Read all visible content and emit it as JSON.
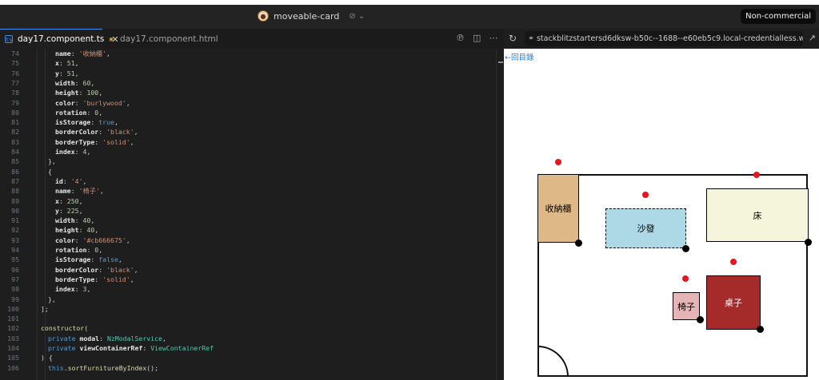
{
  "window": {
    "project_name": "moveable-card",
    "badge": "Non-commercial"
  },
  "tabs": [
    {
      "label": "day17.component.ts",
      "type_icon": "ts"
    },
    {
      "label": "day17.component.html",
      "type_icon": "html"
    }
  ],
  "browser": {
    "url": "stackblitzstartersd6dksw-b50c--1688--e60eb5c9.local-credentialless.we...",
    "back_link": "←回目錄"
  },
  "editor": {
    "lines": [
      {
        "n": "74",
        "tokens": [
          [
            "k",
            "name"
          ],
          [
            "p",
            ": "
          ],
          [
            "s",
            "'收納櫃'"
          ],
          [
            "p",
            ","
          ]
        ]
      },
      {
        "n": "75",
        "tokens": [
          [
            "k",
            "x"
          ],
          [
            "p",
            ": "
          ],
          [
            "n",
            "51"
          ],
          [
            "p",
            ","
          ]
        ]
      },
      {
        "n": "76",
        "tokens": [
          [
            "k",
            "y"
          ],
          [
            "p",
            ": "
          ],
          [
            "n",
            "51"
          ],
          [
            "p",
            ","
          ]
        ]
      },
      {
        "n": "77",
        "tokens": [
          [
            "k",
            "width"
          ],
          [
            "p",
            ": "
          ],
          [
            "n",
            "60"
          ],
          [
            "p",
            ","
          ]
        ]
      },
      {
        "n": "78",
        "tokens": [
          [
            "k",
            "height"
          ],
          [
            "p",
            ": "
          ],
          [
            "n",
            "100"
          ],
          [
            "p",
            ","
          ]
        ]
      },
      {
        "n": "79",
        "tokens": [
          [
            "k",
            "color"
          ],
          [
            "p",
            ": "
          ],
          [
            "s",
            "'burlywood'"
          ],
          [
            "p",
            ","
          ]
        ]
      },
      {
        "n": "80",
        "tokens": [
          [
            "k",
            "rotation"
          ],
          [
            "p",
            ": "
          ],
          [
            "n",
            "0"
          ],
          [
            "p",
            ","
          ]
        ]
      },
      {
        "n": "81",
        "tokens": [
          [
            "k",
            "isStorage"
          ],
          [
            "p",
            ": "
          ],
          [
            "kw",
            "true"
          ],
          [
            "p",
            ","
          ]
        ]
      },
      {
        "n": "82",
        "tokens": [
          [
            "k",
            "borderColor"
          ],
          [
            "p",
            ": "
          ],
          [
            "s",
            "'black'"
          ],
          [
            "p",
            ","
          ]
        ]
      },
      {
        "n": "83",
        "tokens": [
          [
            "k",
            "borderType"
          ],
          [
            "p",
            ": "
          ],
          [
            "s",
            "'solid'"
          ],
          [
            "p",
            ","
          ]
        ]
      },
      {
        "n": "84",
        "tokens": [
          [
            "k",
            "index"
          ],
          [
            "p",
            ": "
          ],
          [
            "n",
            "4"
          ],
          [
            "p",
            ","
          ]
        ]
      },
      {
        "n": "85",
        "tokens": [
          [
            "p",
            "},"
          ]
        ]
      },
      {
        "n": "86",
        "tokens": [
          [
            "p",
            "{"
          ]
        ]
      },
      {
        "n": "87",
        "tokens": [
          [
            "k",
            "id"
          ],
          [
            "p",
            ": "
          ],
          [
            "s",
            "'4'"
          ],
          [
            "p",
            ","
          ]
        ]
      },
      {
        "n": "88",
        "tokens": [
          [
            "k",
            "name"
          ],
          [
            "p",
            ": "
          ],
          [
            "s",
            "'椅子'"
          ],
          [
            "p",
            ","
          ]
        ]
      },
      {
        "n": "89",
        "tokens": [
          [
            "k",
            "x"
          ],
          [
            "p",
            ": "
          ],
          [
            "n",
            "250"
          ],
          [
            "p",
            ","
          ]
        ]
      },
      {
        "n": "90",
        "tokens": [
          [
            "k",
            "y"
          ],
          [
            "p",
            ": "
          ],
          [
            "n",
            "225"
          ],
          [
            "p",
            ","
          ]
        ]
      },
      {
        "n": "91",
        "tokens": [
          [
            "k",
            "width"
          ],
          [
            "p",
            ": "
          ],
          [
            "n",
            "40"
          ],
          [
            "p",
            ","
          ]
        ]
      },
      {
        "n": "92",
        "tokens": [
          [
            "k",
            "height"
          ],
          [
            "p",
            ": "
          ],
          [
            "n",
            "40"
          ],
          [
            "p",
            ","
          ]
        ]
      },
      {
        "n": "93",
        "tokens": [
          [
            "k",
            "color"
          ],
          [
            "p",
            ": "
          ],
          [
            "s",
            "'#cb666675'"
          ],
          [
            "p",
            ","
          ]
        ]
      },
      {
        "n": "94",
        "tokens": [
          [
            "k",
            "rotation"
          ],
          [
            "p",
            ": "
          ],
          [
            "n",
            "0"
          ],
          [
            "p",
            ","
          ]
        ]
      },
      {
        "n": "95",
        "tokens": [
          [
            "k",
            "isStorage"
          ],
          [
            "p",
            ": "
          ],
          [
            "kw",
            "false"
          ],
          [
            "p",
            ","
          ]
        ]
      },
      {
        "n": "96",
        "tokens": [
          [
            "k",
            "borderColor"
          ],
          [
            "p",
            ": "
          ],
          [
            "s",
            "'black'"
          ],
          [
            "p",
            ","
          ]
        ]
      },
      {
        "n": "97",
        "tokens": [
          [
            "k",
            "borderType"
          ],
          [
            "p",
            ": "
          ],
          [
            "s",
            "'solid'"
          ],
          [
            "p",
            ","
          ]
        ]
      },
      {
        "n": "98",
        "tokens": [
          [
            "k",
            "index"
          ],
          [
            "p",
            ": "
          ],
          [
            "n",
            "3"
          ],
          [
            "p",
            ","
          ]
        ]
      },
      {
        "n": "99",
        "tokens": [
          [
            "p",
            "},"
          ]
        ]
      },
      {
        "n": "100",
        "tokens": [
          [
            "p",
            "];"
          ]
        ]
      },
      {
        "n": "101",
        "tokens": []
      },
      {
        "n": "102",
        "tokens": [
          [
            "fn",
            "constructor"
          ],
          [
            "p",
            "("
          ]
        ]
      },
      {
        "n": "103",
        "tokens": [
          [
            "kw",
            "private "
          ],
          [
            "k",
            "modal"
          ],
          [
            "p",
            ": "
          ],
          [
            "ty",
            "NzModalService"
          ],
          [
            "p",
            ","
          ]
        ]
      },
      {
        "n": "104",
        "tokens": [
          [
            "kw",
            "private "
          ],
          [
            "k",
            "viewContainerRef"
          ],
          [
            "p",
            ": "
          ],
          [
            "ty",
            "ViewContainerRef"
          ]
        ]
      },
      {
        "n": "105",
        "tokens": [
          [
            "p",
            ") {"
          ]
        ]
      },
      {
        "n": "106",
        "tokens": [
          [
            "kw",
            "this"
          ],
          [
            "p",
            "."
          ],
          [
            "fn",
            "sortFurnitureByIndex"
          ],
          [
            "p",
            "();"
          ]
        ]
      }
    ]
  },
  "furniture": [
    {
      "name": "收納櫃",
      "color": "#deb887"
    },
    {
      "name": "沙發",
      "color": "#add8e6"
    },
    {
      "name": "床",
      "color": "#f5f5dc"
    },
    {
      "name": "椅子",
      "color": "#e6b4b4"
    },
    {
      "name": "桌子",
      "color": "#a52a2a"
    }
  ]
}
